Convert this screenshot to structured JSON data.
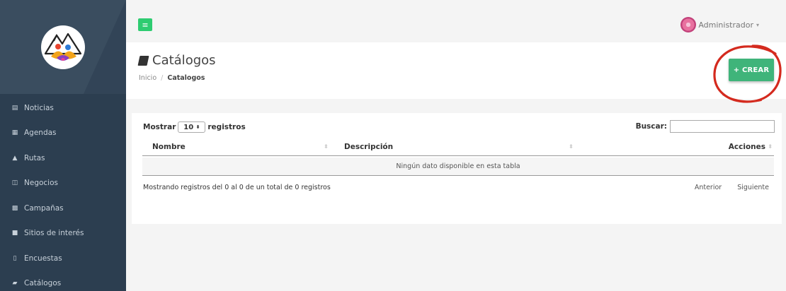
{
  "sidebar": {
    "items": [
      {
        "label": "Noticias",
        "icon": "newspaper-icon",
        "glyph": "▤"
      },
      {
        "label": "Agendas",
        "icon": "calendar-icon",
        "glyph": "▦"
      },
      {
        "label": "Rutas",
        "icon": "binoculars-icon",
        "glyph": "▲"
      },
      {
        "label": "Negocios",
        "icon": "money-icon",
        "glyph": "◫"
      },
      {
        "label": "Campañas",
        "icon": "grid-icon",
        "glyph": "▩"
      },
      {
        "label": "Sitios de interés",
        "icon": "building-icon",
        "glyph": "■"
      },
      {
        "label": "Encuestas",
        "icon": "document-icon",
        "glyph": "▯"
      },
      {
        "label": "Catálogos",
        "icon": "book-icon",
        "glyph": "▰"
      }
    ]
  },
  "topbar": {
    "user_name": "Administrador",
    "menu_glyph": "≡"
  },
  "header": {
    "title": "Catálogos",
    "breadcrumb": {
      "home": "Inicio",
      "current": "Catalogos"
    },
    "create_button": "+ CREAR"
  },
  "table_controls": {
    "show_prefix": "Mostrar",
    "page_length": "10",
    "show_suffix": "registros",
    "search_label": "Buscar:",
    "search_value": ""
  },
  "table": {
    "columns": [
      "Nombre",
      "Descripción",
      "Acciones"
    ],
    "empty_message": "Ningún dato disponible en esta tabla",
    "info": "Mostrando registros del 0 al 0 de un total de 0 registros",
    "prev": "Anterior",
    "next": "Siguiente"
  },
  "colors": {
    "sidebar_bg": "#2c3e50",
    "accent_green": "#3fb47a",
    "highlight_red": "#d42a1e"
  }
}
